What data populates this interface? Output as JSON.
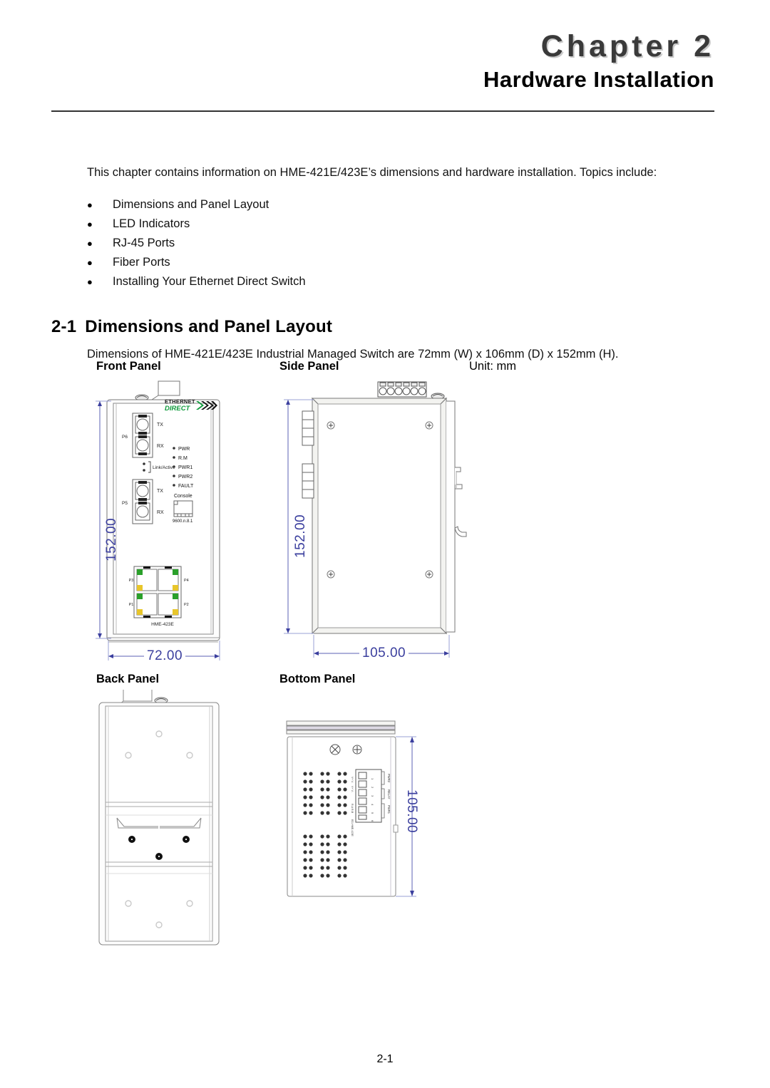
{
  "header": {
    "chapter_label": "Chapter 2",
    "chapter_title": "Hardware Installation"
  },
  "intro": {
    "paragraph": "This chapter contains information on HME-421E/423E’s dimensions and hardware installation. Topics include:",
    "bullet_glyph": "●",
    "topics": [
      {
        "label": "Dimensions and Panel Layout"
      },
      {
        "label": "LED Indicators"
      },
      {
        "label": "RJ-45 Ports"
      },
      {
        "label": "Fiber Ports"
      },
      {
        "label": "Installing Your Ethernet Direct Switch"
      }
    ]
  },
  "section": {
    "number": "2-1",
    "title": "Dimensions and Panel Layout",
    "description": "Dimensions of HME-421E/423E Industrial Managed Switch are 72mm (W) x 106mm (D) x 152mm (H)."
  },
  "captions": {
    "front_panel": "Front Panel",
    "side_panel": "Side Panel",
    "unit_note": "Unit: mm",
    "back_panel": "Back Panel",
    "bottom_panel": "Bottom Panel"
  },
  "front_panel": {
    "brand_line1": "ETHERNET",
    "brand_line2": "DIRECT",
    "fiber_ports": [
      {
        "id": "P6",
        "tx": "TX",
        "rx": "RX"
      },
      {
        "id": "P5",
        "tx": "TX",
        "rx": "RX"
      }
    ],
    "link_active_label": "Link/Active",
    "leds": [
      "PWR",
      "R.M",
      "PWR1",
      "PWR2",
      "FAULT"
    ],
    "console_label": "Console",
    "console_setting": "9600.n.8.1",
    "rj45_ports": [
      "P3",
      "P4",
      "P1",
      "P2"
    ],
    "model_label": "HME-423E",
    "dim_height": "152.00",
    "dim_width": "72.00",
    "led_green": "#2aa02a",
    "led_yellow": "#e8c62b",
    "brand_green": "#0f9a3c"
  },
  "side_panel": {
    "dim_height": "152.00",
    "dim_width": "105.00",
    "terminal_count": 6
  },
  "bottom_panel": {
    "dim_depth": "105.00",
    "terminal_numbers": [
      "1",
      "2",
      "3",
      "4",
      "5",
      "6"
    ],
    "terminal_groups": [
      "PWR2",
      "RELAY",
      "PWR1"
    ],
    "vent_label": "ED-HME-423E"
  },
  "footer": {
    "page_number": "2-1"
  },
  "colors": {
    "dimension_blue": "#3b3f9e",
    "chapter_gray": "#3a3a3a",
    "rule_dark": "#333333"
  }
}
